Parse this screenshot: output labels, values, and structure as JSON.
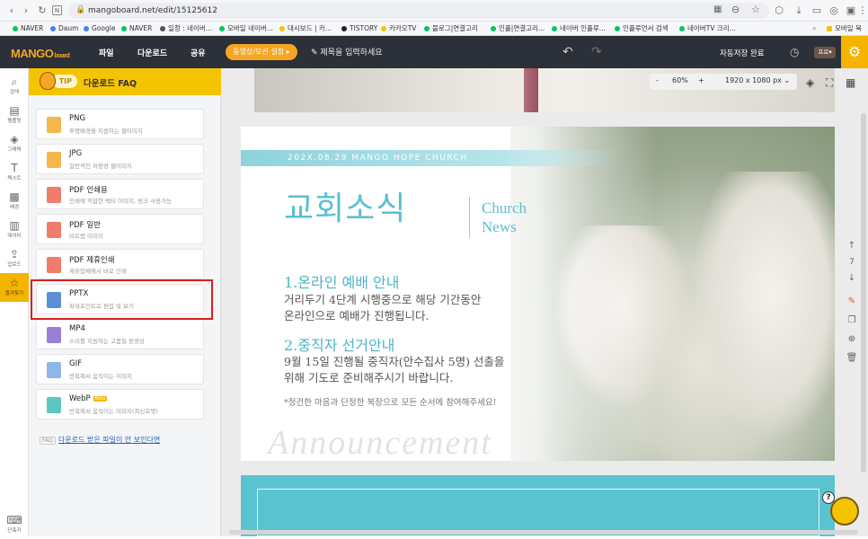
{
  "browser": {
    "url": "mangoboard.net/edit/15125612",
    "bookmarks": [
      {
        "label": "NAVER",
        "color": "#03c75a"
      },
      {
        "label": "Daum",
        "color": "#4d7cfe"
      },
      {
        "label": "Google",
        "color": "#4285f4"
      },
      {
        "label": "NAVER",
        "color": "#03c75a"
      },
      {
        "label": "일정 : 네이버...",
        "color": "#555555"
      },
      {
        "label": "모바일 네이버...",
        "color": "#03c75a"
      },
      {
        "label": "대시보드 | 카...",
        "color": "#f5c400"
      },
      {
        "label": "TISTORY",
        "color": "#222222"
      },
      {
        "label": "카카오TV",
        "color": "#f5c400"
      },
      {
        "label": "블로그|연결고리",
        "color": "#03c75a"
      },
      {
        "label": "인플|연결고리...",
        "color": "#03c75a"
      },
      {
        "label": "네이버 인플루...",
        "color": "#03c75a"
      },
      {
        "label": "인플루언서 검색",
        "color": "#03c75a"
      },
      {
        "label": "네이버TV 크리...",
        "color": "#03c75a"
      },
      {
        "label": "모바일 북",
        "color": "#f5c400"
      }
    ]
  },
  "app": {
    "logo": "MANGO",
    "logo_sub": "board",
    "menu": [
      "파일",
      "다운로드",
      "공유"
    ],
    "media_button": "동영상/모션 설정",
    "title_placeholder": "제목을 입력하세요",
    "autosave": "자동저장 완료",
    "profile_badge": "프로"
  },
  "rail": [
    {
      "icon": "search-icon",
      "label": "검색"
    },
    {
      "icon": "template-icon",
      "label": "템플릿"
    },
    {
      "icon": "graphic-icon",
      "label": "그래픽"
    },
    {
      "icon": "text-icon",
      "label": "텍스트"
    },
    {
      "icon": "background-icon",
      "label": "배경"
    },
    {
      "icon": "chart-icon",
      "label": "데이터"
    },
    {
      "icon": "upload-icon",
      "label": "업로드"
    },
    {
      "icon": "star-icon",
      "label": "즐겨찾기"
    },
    {
      "icon": "keyboard-icon",
      "label": "단축키"
    }
  ],
  "panel": {
    "tip": "TIP",
    "title": "다운로드 FAQ",
    "formats": [
      {
        "name": "PNG",
        "desc": "투명배경을 지원하는 웹이미지",
        "color": "#f5b74c"
      },
      {
        "name": "JPG",
        "desc": "일반적인 저용량 웹이미지",
        "color": "#f5b74c"
      },
      {
        "name": "PDF 인쇄용",
        "desc": "인쇄에 적합한 벡터 이미지, 링크 사용가능",
        "color": "#f07c6a"
      },
      {
        "name": "PDF 일반",
        "desc": "비트맵 이미지",
        "color": "#f07c6a"
      },
      {
        "name": "PDF 제휴인쇄",
        "desc": "제휴업체에서 바로 인쇄",
        "color": "#f07c6a"
      },
      {
        "name": "PPTX",
        "desc": "파워포인트로 편집 및 보기",
        "color": "#5b8fd6"
      },
      {
        "name": "MP4",
        "desc": "소리를 지원하는 고품질 동영상",
        "color": "#9b7fd6"
      },
      {
        "name": "GIF",
        "desc": "반복해서 움직이는 이미지",
        "color": "#8fb6e8"
      },
      {
        "name": "WebP",
        "desc": "반복해서 움직이는 이미지(최신포맷)",
        "color": "#5cc7c0",
        "badge": "Beta"
      }
    ],
    "faq_badge": "FAQ",
    "faq_link": "다운로드 받은 파일이 안 보인다면"
  },
  "toolbar": {
    "zoom": "60%",
    "zoom_minus": "-",
    "zoom_plus": "+",
    "size": "1920 x 1080 px"
  },
  "design": {
    "date_line": "202X.08.29 MANGO HOPE CHURCH",
    "title_ko": "교회소식",
    "title_en_1": "Church",
    "title_en_2": "News",
    "item1_title": "1.온라인 예배 안내",
    "item1_line1": "거리두기 4단계 시행중으로 해당 기간동안",
    "item1_line2": "온라인으로 예배가 진행됩니다.",
    "item2_title": "2.중직자 선거안내",
    "item2_line1": "9월 15일 진행될 중직자(안수집사 5명) 선출을",
    "item2_line2": "위해 기도로 준비해주시기 바랍니다.",
    "note": "*정건한 마음과 단정한 복장으로 모든 순서에 참여해주세요!",
    "script_text": "Announcement"
  },
  "page_nav": {
    "current": "7"
  },
  "help": "?"
}
